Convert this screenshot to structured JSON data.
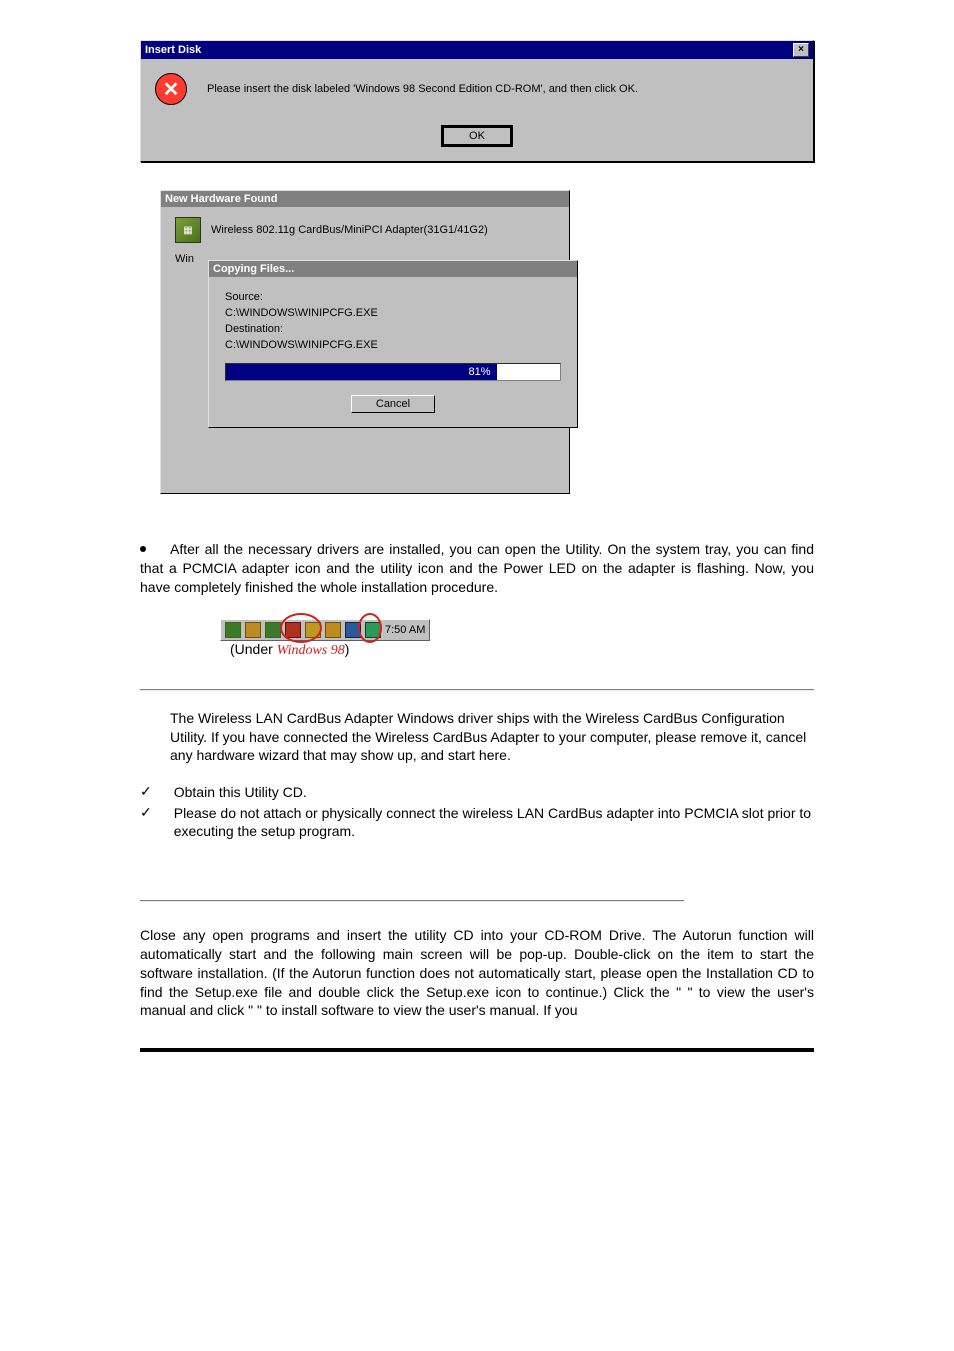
{
  "dlg1": {
    "title": "Insert Disk",
    "close_glyph": "×",
    "icon_glyph": "✕",
    "message": "Please insert the disk labeled 'Windows 98 Second Edition CD-ROM', and then click OK.",
    "ok_label": "OK"
  },
  "dlg_outer": {
    "title": "New Hardware Found",
    "device": "Wireless 802.11g CardBus/MiniPCI Adapter(31G1/41G2)",
    "left_text": "Win"
  },
  "dlg_inner": {
    "title": "Copying Files...",
    "source_label": "Source:",
    "source_value": "C:\\WINDOWS\\WINIPCFG.EXE",
    "dest_label": "Destination:",
    "dest_value": "C:\\WINDOWS\\WINIPCFG.EXE",
    "percent_text": "81%",
    "percent_value": 81,
    "cancel_label": "Cancel"
  },
  "tray": {
    "time": "7:50 AM",
    "caption_prefix": "(Under ",
    "caption_os": "Windows 98",
    "caption_suffix": ")"
  },
  "bullet_paragraph": "After all the necessary drivers are installed, you can open the Utility. On the system tray, you can find that a PCMCIA adapter icon and the utility icon and the Power LED on the adapter is flashing. Now, you have completely finished the whole installation procedure.",
  "section1_para": "The Wireless LAN CardBus Adapter Windows driver ships with the Wireless CardBus Configuration Utility. If you have connected the Wireless CardBus Adapter to your computer, please remove it, cancel any hardware wizard that may show up, and start here.",
  "checks": [
    "Obtain this Utility CD.",
    "Please do not attach or physically connect the wireless LAN CardBus adapter into PCMCIA slot prior to executing the setup program."
  ],
  "para2": {
    "t1": "Close any open programs and insert the utility CD into your CD-ROM Drive. The Autorun function will automatically start and the following main screen will be pop-up. Double-click on the ",
    "t2": " item to start the software installation. (If the Autorun function does not automatically start, please open the Installation CD to find the Setup.exe file and double click the Setup.exe icon to continue.) Click the \" ",
    "t3": " \" to view the user's manual and click \" ",
    "t4": " \" to install software to view the user's manual. If you"
  }
}
